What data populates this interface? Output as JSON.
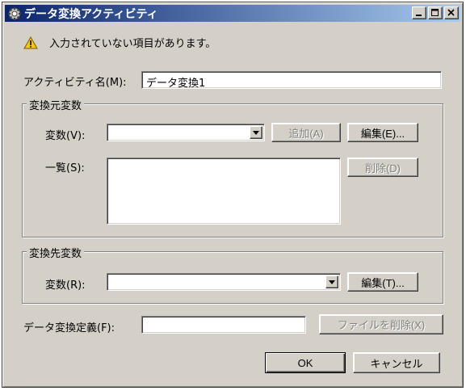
{
  "window": {
    "title": "データ変換アクティビティ",
    "title_icon": "gear-icon",
    "controls": [
      "minimize-icon",
      "maximize-icon",
      "close-icon"
    ]
  },
  "message": {
    "icon": "warning-icon",
    "text": "入力されていない項目があります。"
  },
  "activity_name": {
    "label": "アクティビティ名(M):",
    "value": "データ変換1"
  },
  "source_group": {
    "title": "変換元変数",
    "variable_label": "変数(V):",
    "variable_value": "",
    "add_button": "追加(A)",
    "edit_button": "編集(E)...",
    "list_label": "一覧(S):",
    "list_items": [],
    "delete_button": "削除(D)"
  },
  "target_group": {
    "title": "変換先変数",
    "variable_label": "変数(R):",
    "variable_value": "",
    "edit_button": "編集(T)..."
  },
  "definition": {
    "label": "データ変換定義(F):",
    "value": "",
    "delete_file_button": "ファイルを削除(X)"
  },
  "footer": {
    "ok_button": "OK",
    "cancel_button": "キャンセル"
  },
  "colors": {
    "title_start": "#0a246a",
    "title_end": "#a6caf0",
    "face": "#d4d0c8",
    "warning": "#f5c518"
  }
}
